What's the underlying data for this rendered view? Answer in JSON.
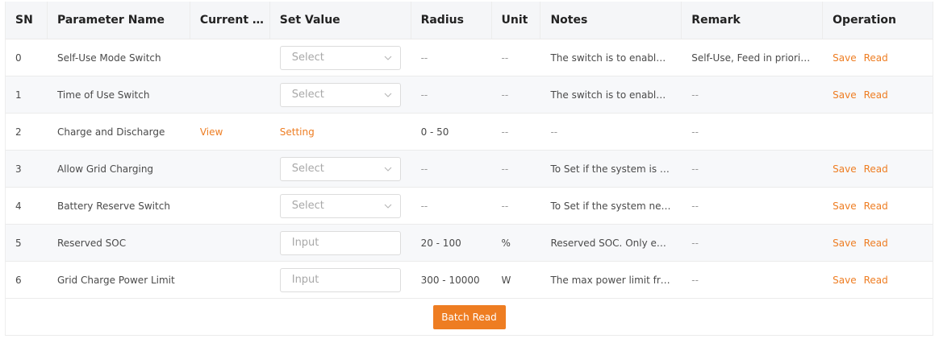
{
  "table": {
    "headers": {
      "sn": "SN",
      "name": "Parameter Name",
      "current": "Current V...",
      "set": "Set Value",
      "radius": "Radius",
      "unit": "Unit",
      "notes": "Notes",
      "remark": "Remark",
      "operation": "Operation"
    },
    "select_placeholder": "Select",
    "input_placeholder": "Input",
    "save_label": "Save",
    "read_label": "Read",
    "rows": [
      {
        "sn": "0",
        "name": "Self-Use Mode Switch",
        "current": "",
        "set_type": "select",
        "radius": "--",
        "unit": "--",
        "notes": "The switch is to enable/di...",
        "remark": "Self-Use, Feed in priority ..."
      },
      {
        "sn": "1",
        "name": "Time of Use Switch",
        "current": "",
        "set_type": "select",
        "radius": "--",
        "unit": "--",
        "notes": "The switch is to enable/di...",
        "remark": "--"
      },
      {
        "sn": "2",
        "name": "Charge and Discharge",
        "current": "View",
        "set_type": "link",
        "set_link": "Setting",
        "radius": "0 - 50",
        "unit": "--",
        "notes": "--",
        "remark": "--"
      },
      {
        "sn": "3",
        "name": "Allow Grid Charging",
        "current": "",
        "set_type": "select",
        "radius": "--",
        "unit": "--",
        "notes": "To Set if the system is allo...",
        "remark": "--"
      },
      {
        "sn": "4",
        "name": "Battery Reserve Switch",
        "current": "",
        "set_type": "select",
        "radius": "--",
        "unit": "--",
        "notes": "To Set if the system needs...",
        "remark": "--"
      },
      {
        "sn": "5",
        "name": "Reserved SOC",
        "current": "",
        "set_type": "input",
        "radius": "20 - 100",
        "unit": "%",
        "notes": "Reserved SOC. Only effect...",
        "remark": "--"
      },
      {
        "sn": "6",
        "name": "Grid Charge Power Limit",
        "current": "",
        "set_type": "input",
        "radius": "300 - 10000",
        "unit": "W",
        "notes": "The max power limit from...",
        "remark": "--"
      }
    ]
  },
  "footer": {
    "batch_read_label": "Batch Read"
  },
  "colors": {
    "accent": "#ee7d22",
    "header_bg": "#f5f6f8",
    "row_alt_bg": "#f7f8fa"
  }
}
